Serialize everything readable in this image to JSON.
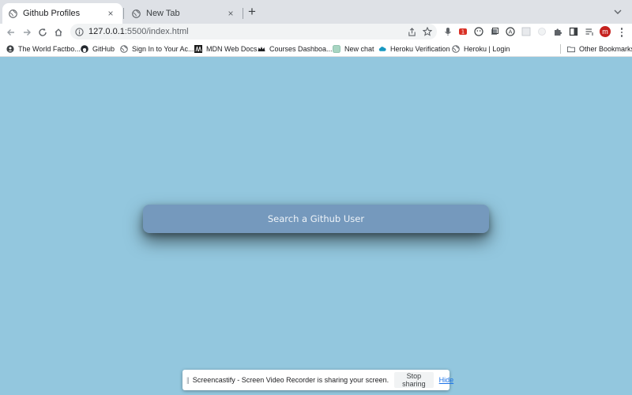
{
  "browser": {
    "tabs": [
      {
        "title": "Github Profiles",
        "active": true,
        "close": "×"
      },
      {
        "title": "New Tab",
        "active": false,
        "close": "×"
      }
    ],
    "new_tab": "+",
    "url_host": "127.0.0.1",
    "url_path": ":5500/index.html",
    "profile_initial": "m",
    "extensions": [
      "share-icon",
      "star-icon",
      "mic-icon",
      "ext-red-icon",
      "ext-face-icon",
      "ext-layers-icon",
      "ext-a-icon",
      "ext-grid-icon",
      "ext-cloud-icon",
      "puzzle-icon",
      "side-panel-icon",
      "list-icon"
    ]
  },
  "bookmarks": {
    "items": [
      {
        "label": "The World Factbo...",
        "icon": "factbook-icon"
      },
      {
        "label": "GitHub",
        "icon": "github-icon"
      },
      {
        "label": "Sign In to Your Ac...",
        "icon": "globe-icon"
      },
      {
        "label": "MDN Web Docs",
        "icon": "mdn-icon"
      },
      {
        "label": "Courses Dashboa...",
        "icon": "crown-icon"
      },
      {
        "label": "New chat",
        "icon": "chat-icon"
      },
      {
        "label": "Heroku Verification",
        "icon": "cloud-icon"
      },
      {
        "label": "Heroku | Login",
        "icon": "globe-icon"
      }
    ],
    "other": "Other Bookmarks"
  },
  "main": {
    "search_placeholder": "Search a Github User",
    "colors": {
      "background": "#93c7de",
      "search_box": "#7599bd"
    }
  },
  "share_bar": {
    "message": "Screencastify - Screen Video Recorder is sharing your screen.",
    "stop_label": "Stop sharing",
    "hide_label": "Hide"
  }
}
